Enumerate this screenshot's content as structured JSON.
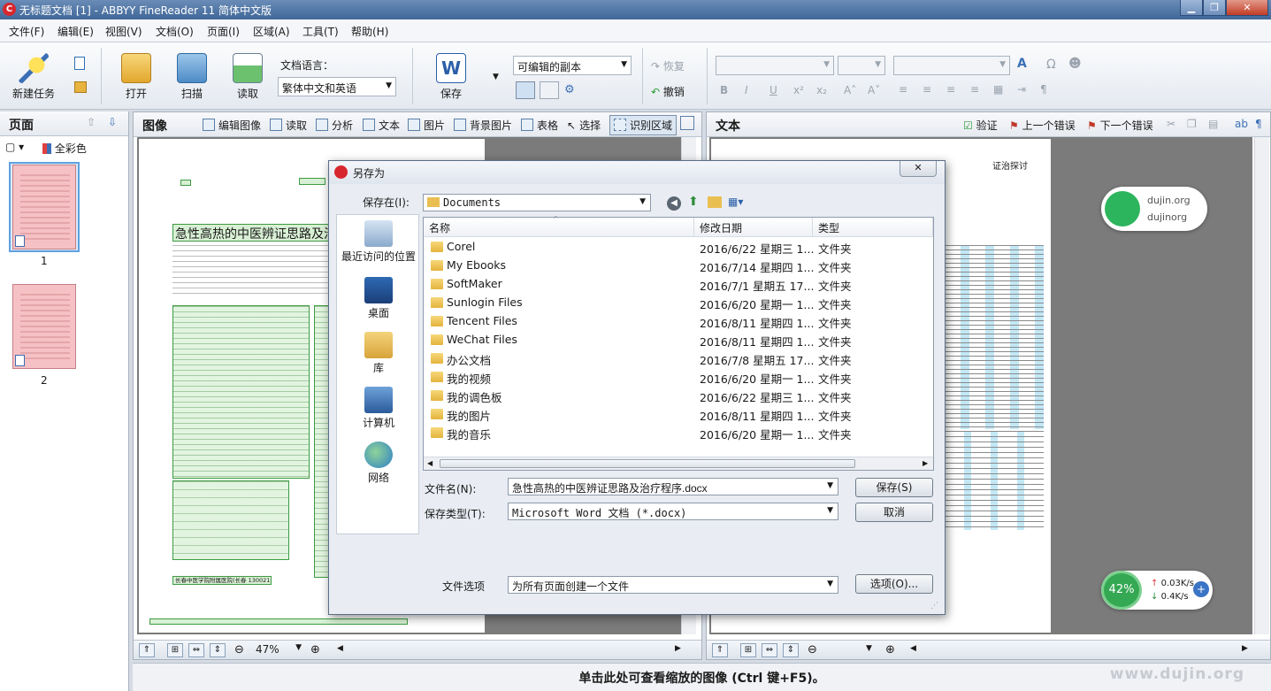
{
  "window": {
    "title": "无标题文档 [1] - ABBYY FineReader 11 简体中文版"
  },
  "menu": [
    "文件(F)",
    "编辑(E)",
    "视图(V)",
    "文档(O)",
    "页面(I)",
    "区域(A)",
    "工具(T)",
    "帮助(H)"
  ],
  "toolbar": {
    "new_task": "新建任务",
    "open": "打开",
    "scan": "扫描",
    "read": "读取",
    "doc_lang_label": "文档语言：",
    "doc_lang_value": "繁体中文和英语",
    "save": "保存",
    "save_mode": "可编辑的副本",
    "redo": "恢复",
    "undo": "撤销"
  },
  "pages_pane": {
    "title": "页面",
    "color_mode": "全彩色",
    "pages": [
      "1",
      "2"
    ]
  },
  "image_pane": {
    "title": "图像",
    "tools": [
      "编辑图像",
      "读取",
      "分析",
      "文本",
      "图片",
      "背景图片",
      "表格",
      "选择",
      "识别区域"
    ],
    "zoom": "47%",
    "doc_title": "急性高热的中医辨证思路及治疗",
    "doc_footer": "长春中医学院附属医院(长春 130021)"
  },
  "text_pane": {
    "title": "文本",
    "tools": [
      "验证",
      "上一个错误",
      "下一个错误"
    ],
    "snippet": "证治探讨"
  },
  "status": {
    "hint": "单击此处可查看缩放的图像 (Ctrl 键+F5)。"
  },
  "dialog": {
    "title": "另存为",
    "save_in_label": "保存在(I):",
    "save_in_value": "Documents",
    "places": [
      "最近访问的位置",
      "桌面",
      "库",
      "计算机",
      "网络"
    ],
    "columns": [
      "名称",
      "修改日期",
      "类型"
    ],
    "files": [
      {
        "name": "Corel",
        "date": "2016/6/22 星期三 1...",
        "type": "文件夹"
      },
      {
        "name": "My Ebooks",
        "date": "2016/7/14 星期四 1...",
        "type": "文件夹"
      },
      {
        "name": "SoftMaker",
        "date": "2016/7/1 星期五 17...",
        "type": "文件夹"
      },
      {
        "name": "Sunlogin Files",
        "date": "2016/6/20 星期一 1...",
        "type": "文件夹"
      },
      {
        "name": "Tencent Files",
        "date": "2016/8/11 星期四 1...",
        "type": "文件夹"
      },
      {
        "name": "WeChat Files",
        "date": "2016/8/11 星期四 1...",
        "type": "文件夹"
      },
      {
        "name": "办公文档",
        "date": "2016/7/8 星期五 17...",
        "type": "文件夹"
      },
      {
        "name": "我的视频",
        "date": "2016/6/20 星期一 1...",
        "type": "文件夹"
      },
      {
        "name": "我的调色板",
        "date": "2016/6/22 星期三 1...",
        "type": "文件夹"
      },
      {
        "name": "我的图片",
        "date": "2016/8/11 星期四 1...",
        "type": "文件夹"
      },
      {
        "name": "我的音乐",
        "date": "2016/6/20 星期一 1...",
        "type": "文件夹"
      }
    ],
    "filename_label": "文件名(N):",
    "filename_value": "急性高热的中医辨证思路及治疗程序.docx",
    "filetype_label": "保存类型(T):",
    "filetype_value": "Microsoft Word 文档 (*.docx)",
    "options_label": "文件选项",
    "options_value": "为所有页面创建一个文件",
    "save_button": "保存(S)",
    "cancel_button": "取消",
    "options_button": "选项(O)..."
  },
  "network_widget": {
    "line1": "dujin.org",
    "line2": "dujinorg"
  },
  "speed_widget": {
    "percent": "42%",
    "up": "0.03K/s",
    "down": "0.4K/s"
  },
  "watermark": "www.dujin.org"
}
